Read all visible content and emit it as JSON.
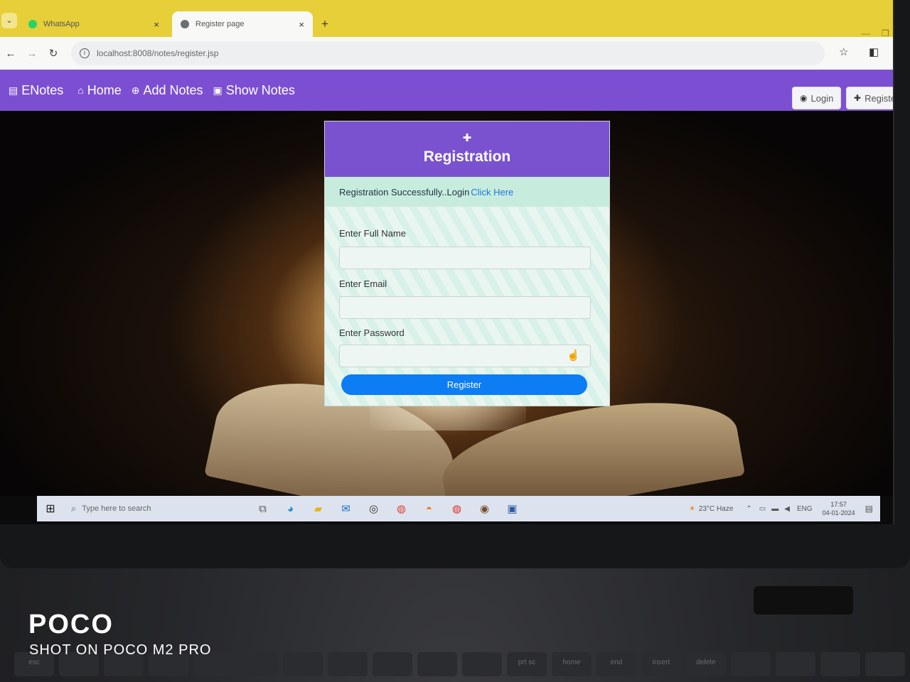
{
  "browser": {
    "tabs": [
      {
        "label": "WhatsApp",
        "active": false,
        "favicon_color": "#25d366"
      },
      {
        "label": "Register page",
        "active": true,
        "favicon_color": "#5f6368"
      }
    ],
    "close_glyph": "×",
    "new_tab_glyph": "+",
    "url": "localhost:8008/notes/register.jsp",
    "nav": {
      "back": "←",
      "forward": "→",
      "reload": "↻"
    },
    "right_icons": {
      "star": "☆",
      "sidepanel": "◧",
      "profile": "●"
    }
  },
  "navbar": {
    "brand": "ENotes",
    "links": [
      {
        "label": "Home",
        "icon": "home-icon"
      },
      {
        "label": "Add Notes",
        "icon": "plus-circle-icon"
      },
      {
        "label": "Show Notes",
        "icon": "book-icon"
      }
    ],
    "login": "Login",
    "register": "Register",
    "color": "#7c4fd2"
  },
  "registration": {
    "title": "Registration",
    "alert_text": "Registration Successfully..Login",
    "alert_link": "Click Here",
    "fields": [
      {
        "label": "Enter Full Name",
        "value": ""
      },
      {
        "label": "Enter Email",
        "value": ""
      },
      {
        "label": "Enter Password",
        "value": ""
      }
    ],
    "submit": "Register"
  },
  "taskbar": {
    "search_placeholder": "Type here to search",
    "weather": "23°C Haze",
    "language": "ENG",
    "time": "17:57",
    "date": "04-01-2024"
  },
  "watermark": {
    "brand": "POCO",
    "shot_on": "SHOT ON POCO M2 PRO"
  },
  "keyboard": {
    "keys": [
      "esc",
      "",
      "",
      "",
      "",
      "",
      "",
      "",
      "",
      "",
      "",
      "prt sc",
      "home",
      "end",
      "insert",
      "delete",
      "",
      "",
      "",
      ""
    ]
  }
}
